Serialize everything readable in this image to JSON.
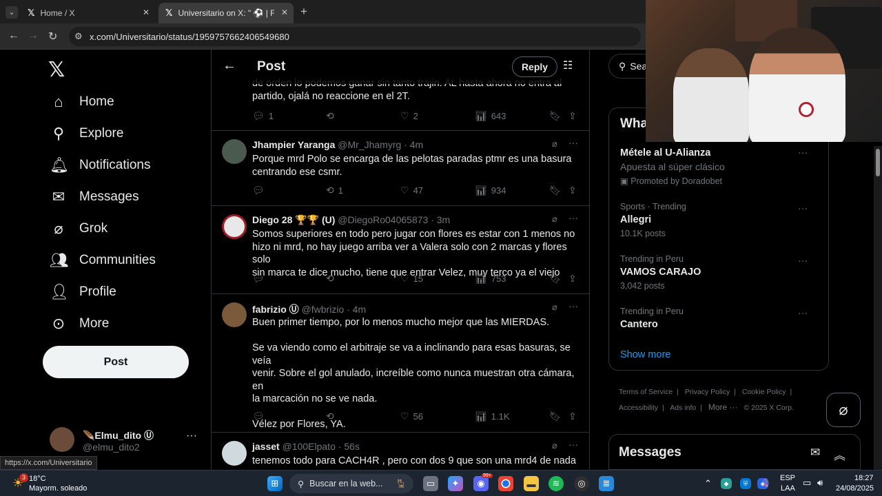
{
  "browser": {
    "tabs": [
      {
        "title": "Home / X",
        "active": false
      },
      {
        "title": "Universitario on X: \" ⚽ | FINAL",
        "active": true
      }
    ],
    "url": "x.com/Universitario/status/1959757662406549680",
    "status_url": "https://x.com/Universitario"
  },
  "nav": {
    "items": [
      {
        "label": "Home",
        "icon": "home-icon"
      },
      {
        "label": "Explore",
        "icon": "search-icon"
      },
      {
        "label": "Notifications",
        "icon": "bell-icon"
      },
      {
        "label": "Messages",
        "icon": "envelope-icon"
      },
      {
        "label": "Grok",
        "icon": "grok-icon"
      },
      {
        "label": "Communities",
        "icon": "people-icon"
      },
      {
        "label": "Profile",
        "icon": "person-icon"
      },
      {
        "label": "More",
        "icon": "more-circle-icon"
      }
    ],
    "post_label": "Post",
    "account": {
      "name": "🪶Elmu_dito Ⓤ",
      "handle": "@elmu_dito2"
    }
  },
  "header": {
    "title": "Post",
    "reply_label": "Reply"
  },
  "tweets": [
    {
      "text": "de orden lo podemos ganar sin tanto trajin. AL hasta ahora no entra al\npartido, ojalá no reaccione en el 2T.",
      "replies": "1",
      "reposts": "",
      "likes": "2",
      "views": "643"
    },
    {
      "name": "Jhampier Yaranga",
      "handle": "@Mr_Jhamyrg",
      "time": "· 4m",
      "text": "Porque mrd Polo se encarga de las pelotas paradas ptmr es una basura\ncentrando ese csmr.",
      "replies": "",
      "reposts": "1",
      "likes": "47",
      "views": "934"
    },
    {
      "name": "Diego 28 🏆🏆 (U)",
      "handle": "@DiegoRo04065873",
      "time": "· 3m",
      "text": "Somos superiores en todo pero jugar con flores es estar con 1 menos no\nhizo ni mrd, no hay juego arriba ver a Valera solo con 2 marcas y flores solo\nsin marca te dice mucho, tiene que entrar Velez, muy terco ya el viejo",
      "replies": "",
      "reposts": "",
      "likes": "15",
      "views": "753"
    },
    {
      "name": "fabrizio Ⓤ",
      "handle": "@fwbrizio",
      "time": "· 4m",
      "text": "Buen primer tiempo, por lo menos mucho mejor que las MIERDAS.\n\nSe va viendo como el arbitraje se va a inclinando para esas basuras, se veía\nvenir. Sobre el gol anulado, increíble como nunca muestran otra cámara, en\nla marcación no se ve nada.\n\nVélez por Flores, YA.",
      "replies": "",
      "reposts": "",
      "likes": "56",
      "views": "1.1K"
    },
    {
      "name": "jasset",
      "handle": "@100Elpato",
      "time": "· 56s",
      "text": "tenemos todo para CACH4R , pero con dos 9 que son una mrd4 de nada",
      "replies": "",
      "reposts": "",
      "likes": "",
      "views": ""
    }
  ],
  "right": {
    "search_placeholder": "Sea",
    "trends_title": "Wha",
    "trends": [
      {
        "sub": "",
        "name": "Métele al U-Alianza",
        "count": "Apuesta al súper clásico",
        "promo": "Promoted by Doradobet"
      },
      {
        "sub": "Sports · Trending",
        "name": "Allegri",
        "count": "10.1K posts"
      },
      {
        "sub": "Trending in Peru",
        "name": "VAMOS CARAJO",
        "count": "3,042 posts"
      },
      {
        "sub": "Trending in Peru",
        "name": "Cantero",
        "count": ""
      }
    ],
    "show_more": "Show more",
    "footer": [
      "Terms of Service",
      "|",
      "Privacy Policy",
      "|",
      "Cookie Policy",
      "|",
      "Accessibility",
      "|",
      "Ads info",
      "|",
      "More ···",
      "© 2025 X Corp."
    ],
    "messages_title": "Messages"
  },
  "taskbar": {
    "weather_temp": "18°C",
    "weather_desc": "Mayorm. soleado",
    "search_placeholder": "Buscar en la web...",
    "lang": "ESP",
    "layout": "LAA",
    "time": "18:27",
    "date": "24/08/2025",
    "badge": "3",
    "discord_badge": "99+"
  },
  "colors": {
    "accent": "#1d9bf0",
    "bg": "#000000",
    "muted": "#71767b",
    "border": "#2f3336"
  }
}
